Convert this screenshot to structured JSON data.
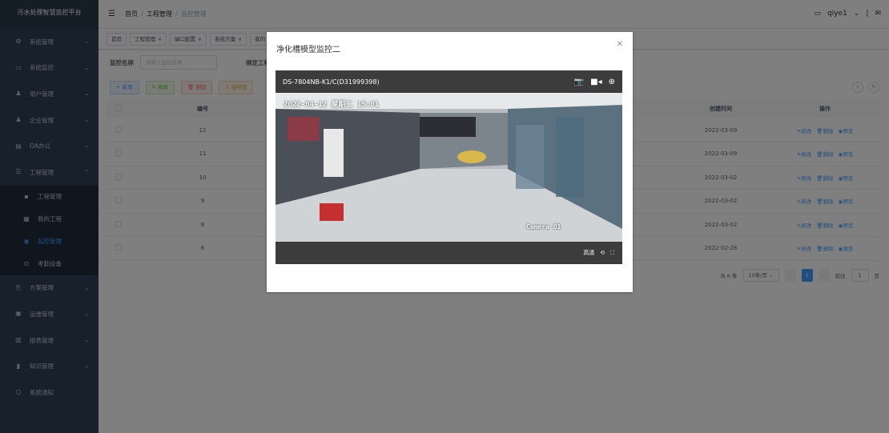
{
  "sidebar": {
    "brand": "污水处理智慧监控平台",
    "items": [
      {
        "label": "系统管理",
        "icon": "gear-icon"
      },
      {
        "label": "系统监控",
        "icon": "monitor-icon"
      },
      {
        "label": "用户管理",
        "icon": "user-icon"
      },
      {
        "label": "企业管理",
        "icon": "user-icon"
      },
      {
        "label": "OA办公",
        "icon": "office-icon"
      },
      {
        "label": "工程管理",
        "icon": "project-icon"
      }
    ],
    "sub": [
      {
        "label": "工程管理",
        "icon": "project-icon"
      },
      {
        "label": "我的工程",
        "icon": "grid-icon"
      },
      {
        "label": "监控管理",
        "icon": "eye-icon"
      },
      {
        "label": "考勤设备",
        "icon": "device-icon"
      }
    ],
    "items2": [
      {
        "label": "方案管理",
        "icon": "plan-icon"
      },
      {
        "label": "运维管理",
        "icon": "ops-icon"
      },
      {
        "label": "报表管理",
        "icon": "report-icon"
      },
      {
        "label": "知识管理",
        "icon": "book-icon"
      },
      {
        "label": "系统通知",
        "icon": "bell-icon"
      }
    ]
  },
  "navbar": {
    "crumbs": [
      "首页",
      "工程管理",
      "监控管理"
    ],
    "user": "qiye1"
  },
  "tags": [
    "首页",
    "工程管理",
    "端口配置",
    "系统方案",
    "我的"
  ],
  "search": {
    "label1": "监控名称",
    "placeholder1": "请输入监控名称",
    "label2": "绑定工程"
  },
  "buttons": {
    "add": "+ 新增",
    "edit": "✎ 修改",
    "del": "🗑 删除",
    "imp": "⇪ 授权登"
  },
  "table": {
    "headers": {
      "id": "编号",
      "created": "创建时间",
      "ops": "操作"
    },
    "rows": [
      {
        "id": "12",
        "date": "2022-03-09"
      },
      {
        "id": "11",
        "date": "2022-03-09"
      },
      {
        "id": "10",
        "date": "2022-03-02"
      },
      {
        "id": "9",
        "date": "2022-03-02"
      },
      {
        "id": "8",
        "date": "2022-03-02"
      },
      {
        "id": "6",
        "date": "2022-02-28"
      }
    ],
    "op_labels": {
      "edit": "修改",
      "del": "删除",
      "view": "预览"
    }
  },
  "pager": {
    "total": "共 6 条",
    "size": "10条/页",
    "page": "1",
    "goto": "前往",
    "jump": "1",
    "unit": "页"
  },
  "dialog": {
    "title": "净化槽模型监控二",
    "device": "DS-7804NB-K1/C(D31999398)",
    "timestamp": "2022-04-12 星期二 15:01",
    "camera": "Camera 01",
    "quality": "高清"
  }
}
